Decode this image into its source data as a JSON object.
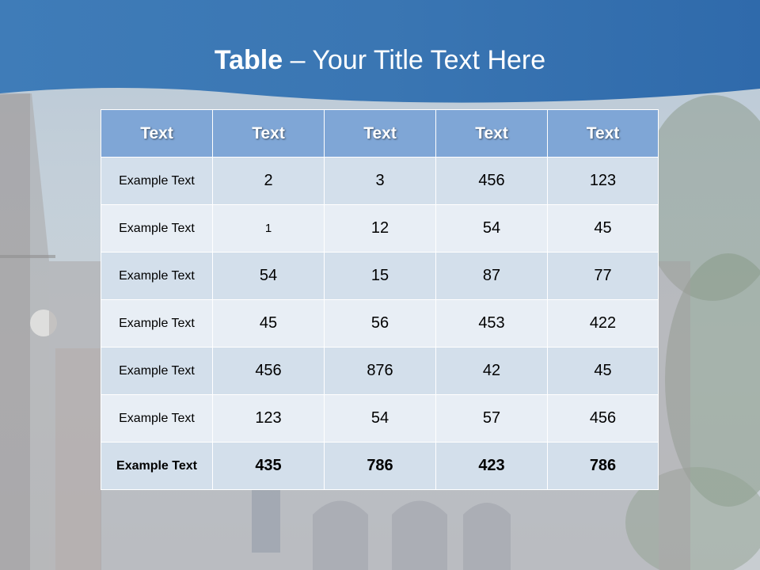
{
  "slide": {
    "title_bold": "Table",
    "title_rest": " – Your Title Text Here"
  },
  "table": {
    "headers": [
      "Text",
      "Text",
      "Text",
      "Text",
      "Text"
    ],
    "rows": [
      [
        "Example Text",
        "2",
        "3",
        "456",
        "123"
      ],
      [
        "Example Text",
        "1",
        "12",
        "54",
        "45"
      ],
      [
        "Example Text",
        "54",
        "15",
        "87",
        "77"
      ],
      [
        "Example Text",
        "45",
        "56",
        "453",
        "422"
      ],
      [
        "Example Text",
        "456",
        "876",
        "42",
        "45"
      ],
      [
        "Example Text",
        "123",
        "54",
        "57",
        "456"
      ],
      [
        "Example Text",
        "435",
        "786",
        "423",
        "786"
      ]
    ]
  },
  "colors": {
    "header_band": "#3d7ab8",
    "table_header": "#7fa6d6",
    "row_dark": "#d3dfeb",
    "row_light": "#e8eef5"
  }
}
